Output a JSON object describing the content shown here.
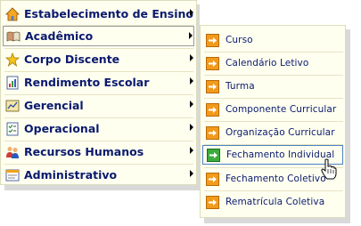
{
  "main_menu": {
    "items": [
      {
        "label": "Estabelecimento de Ensino",
        "icon": "house-icon"
      },
      {
        "label": "Acadêmico",
        "icon": "book-icon"
      },
      {
        "label": "Corpo Discente",
        "icon": "star-icon"
      },
      {
        "label": "Rendimento Escolar",
        "icon": "report-icon"
      },
      {
        "label": "Gerencial",
        "icon": "chart-icon"
      },
      {
        "label": "Operacional",
        "icon": "checklist-icon"
      },
      {
        "label": "Recursos Humanos",
        "icon": "people-icon"
      },
      {
        "label": "Administrativo",
        "icon": "window-icon"
      }
    ]
  },
  "sub_menu": {
    "items": [
      {
        "label": "Curso"
      },
      {
        "label": "Calendário Letivo"
      },
      {
        "label": "Turma"
      },
      {
        "label": "Componente Curricular"
      },
      {
        "label": "Organização Curricular"
      },
      {
        "label": "Fechamento Individual"
      },
      {
        "label": "Fechamento Coletivo"
      },
      {
        "label": "Rematrícula Coletiva"
      }
    ]
  },
  "colors": {
    "menu_bg": "#fffff0",
    "text": "#0a1a6e",
    "arrow_icon_orange": "#f29a1c",
    "arrow_icon_green": "#3bab3b",
    "active_border": "#4a82c4"
  }
}
